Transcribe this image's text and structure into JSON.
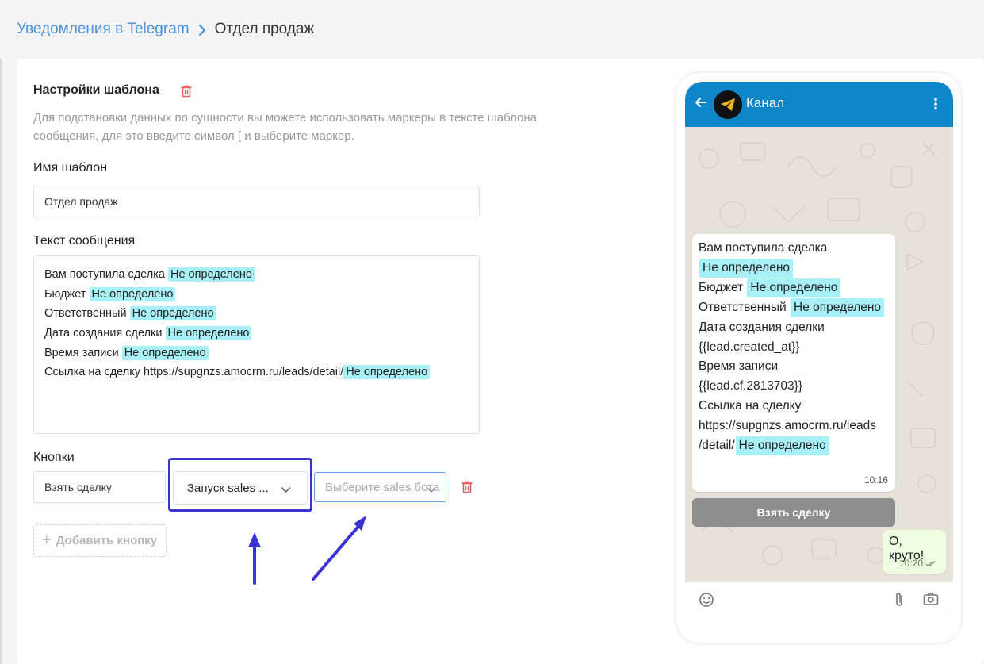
{
  "breadcrumb": {
    "parent": "Уведомления в Telegram",
    "current": "Отдел продаж"
  },
  "settings": {
    "title": "Настройки шаблона",
    "hint": "Для подстановки данных по сущности вы можете использовать маркеры в тексте шаблона сообщения, для это введите символ [ и выберите маркер."
  },
  "template_name": {
    "label": "Имя шаблон",
    "value": "Отдел продаж"
  },
  "message": {
    "label": "Текст сообщения",
    "lines": [
      {
        "text": "Вам поступила сделка ",
        "tag": "Не определено"
      },
      {
        "text": "Бюджет ",
        "tag": "Не определено"
      },
      {
        "text": "Ответственный ",
        "tag": "Не определено"
      },
      {
        "text": "Дата создания сделки ",
        "tag": "Не определено"
      },
      {
        "text": "Время записи ",
        "tag": "Не определено"
      },
      {
        "text": "Ссылка на сделку https://supgnzs.amocrm.ru/leads/detail/",
        "tag": "Не определено"
      }
    ]
  },
  "buttons": {
    "label": "Кнопки",
    "button_text": "Взять сделку",
    "action_select": "Запуск sales ...",
    "sales_bot_placeholder": "Выберите sales бота",
    "add_label": "Добавить кнопку"
  },
  "preview": {
    "channel_name": "Канал",
    "bubble": {
      "l1": "Вам поступила сделка",
      "l2_tag": "Не определено",
      "l3_text": "Бюджет",
      "l3_tag": "Не определено",
      "l4_text": "Ответственный",
      "l4_tag": "Не определено",
      "l5": "Дата создания сделки",
      "l6": "{{lead.created_at}}",
      "l7": "Время записи",
      "l8": "{{lead.cf.2813703}}",
      "l9": "Ссылка на сделку",
      "l10": "https://supgnzs.amocrm.ru/leads",
      "l11_text": "/detail/",
      "l11_tag": "Не определено",
      "time": "10:16"
    },
    "inline_button": "Взять сделку",
    "reply": {
      "text": "О, круто!",
      "time": "10:20"
    }
  },
  "colors": {
    "accent": "#4a90d9",
    "tag_bg": "#a7f0f7",
    "highlight": "#3b33d6",
    "telegram_header": "#0f86c9",
    "delete": "#e65a5a"
  }
}
